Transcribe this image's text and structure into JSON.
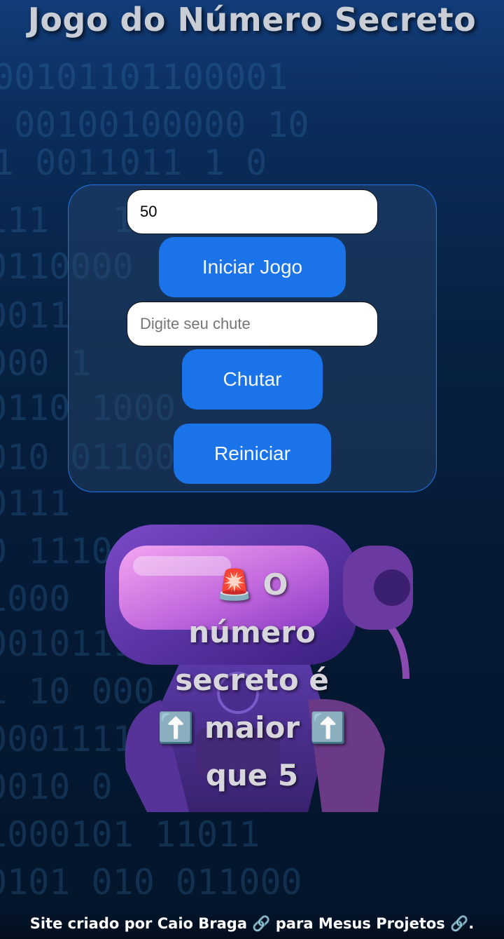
{
  "title": "Jogo do Número Secreto",
  "form": {
    "range_value": "50",
    "start_button": "Iniciar Jogo",
    "guess_placeholder": "Digite seu chute",
    "guess_button": "Chutar",
    "reset_button": "Reiniciar"
  },
  "message": {
    "line1": "🚨 O",
    "line2": "número",
    "line3": "secreto é",
    "line4": "⬆️ maior ⬆️",
    "line5": "que 5"
  },
  "footer": {
    "prefix": "Site criado por ",
    "author": "Caio Braga 🔗",
    "middle": " para ",
    "projects": "Mesus Projetos 🔗",
    "suffix": "."
  },
  "colors": {
    "accent": "#1a73e8",
    "panel_border": "#1f6fd9",
    "background": "#051a36"
  },
  "background_binary": [
    "00101101100001",
    " 00100100000 10",
    "1 0011011 1 0",
    "111   10",
    "0110000",
    "0011",
    "000 1",
    "0110 1000",
    "010 01100",
    "0111",
    "0 1110",
    "1000",
    "00101110",
    "1 10 000",
    "000111111",
    "0010 0",
    "1000101 11011",
    "0101 010 011000"
  ]
}
